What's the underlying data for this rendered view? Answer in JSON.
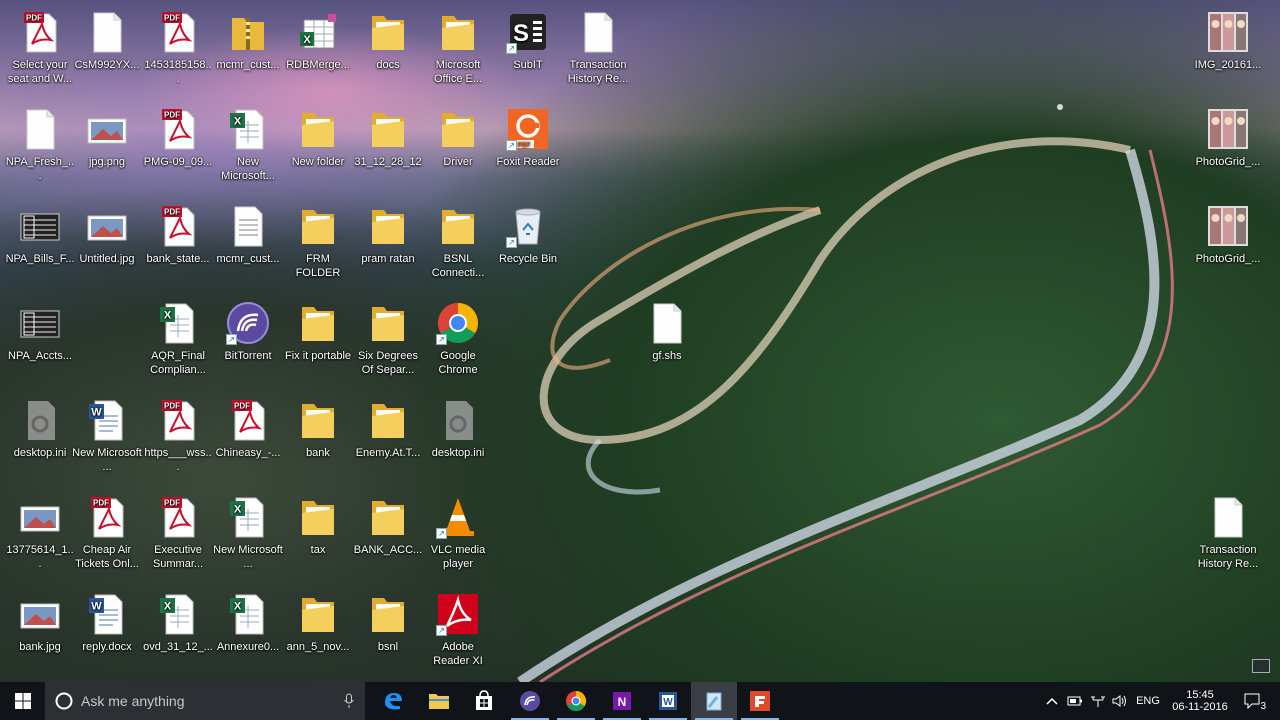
{
  "desktop": {
    "icons": [
      {
        "label": "Select your seat and W...",
        "icon": "pdf-icon"
      },
      {
        "label": "CsM992YX...",
        "icon": "blank-file-icon"
      },
      {
        "label": "1453185158...",
        "icon": "pdf-icon"
      },
      {
        "label": "mcmr_cust...",
        "icon": "zip-folder-icon"
      },
      {
        "label": "RDBMerge...",
        "icon": "excel-addin-icon"
      },
      {
        "label": "docs",
        "icon": "folder-icon"
      },
      {
        "label": "Microsoft Office E...",
        "icon": "folder-icon"
      },
      {
        "label": "SubIT",
        "icon": "subit-app-icon"
      },
      {
        "label": "Transaction History Re...",
        "icon": "blank-file-icon"
      },
      {
        "label": "NPA_Fresh_...",
        "icon": "blank-file-icon"
      },
      {
        "label": "jpg.png",
        "icon": "image-file-icon"
      },
      {
        "label": "PMG-09_09...",
        "icon": "pdf-icon"
      },
      {
        "label": "New Microsoft...",
        "icon": "excel-file-icon"
      },
      {
        "label": "New folder",
        "icon": "folder-icon"
      },
      {
        "label": "31_12_28_12",
        "icon": "folder-icon"
      },
      {
        "label": "Driver",
        "icon": "folder-icon"
      },
      {
        "label": "Foxit Reader",
        "icon": "foxit-reader-icon"
      },
      {
        "label": "NPA_Bills_F...",
        "icon": "spreadsheet-thumbnail-icon"
      },
      {
        "label": "Untitled.jpg",
        "icon": "image-file-icon"
      },
      {
        "label": "bank_state...",
        "icon": "pdf-icon"
      },
      {
        "label": "mcmr_cust...",
        "icon": "text-file-icon"
      },
      {
        "label": "FRM FOLDER",
        "icon": "folder-icon"
      },
      {
        "label": "pram ratan",
        "icon": "folder-icon"
      },
      {
        "label": "BSNL Connecti...",
        "icon": "folder-icon"
      },
      {
        "label": "Recycle Bin",
        "icon": "recycle-bin-icon"
      },
      {
        "label": "NPA_Accts...",
        "icon": "spreadsheet-thumbnail-icon"
      },
      {
        "label": "AQR_Final Complian...",
        "icon": "excel-file-icon"
      },
      {
        "label": "BitTorrent",
        "icon": "bittorrent-icon"
      },
      {
        "label": "Fix it portable",
        "icon": "folder-icon"
      },
      {
        "label": "Six Degrees Of Separ...",
        "icon": "folder-icon"
      },
      {
        "label": "Google Chrome",
        "icon": "chrome-icon"
      },
      {
        "label": "gf.shs",
        "icon": "blank-file-icon"
      },
      {
        "label": "desktop.ini",
        "icon": "settings-file-icon"
      },
      {
        "label": "New Microsoft ...",
        "icon": "word-file-icon"
      },
      {
        "label": "https___wss...",
        "icon": "pdf-icon"
      },
      {
        "label": "Chineasy_-...",
        "icon": "pdf-icon"
      },
      {
        "label": "bank",
        "icon": "folder-icon"
      },
      {
        "label": "Enemy.At.T...",
        "icon": "folder-icon"
      },
      {
        "label": "desktop.ini",
        "icon": "settings-file-icon"
      },
      {
        "label": "13775614_1...",
        "icon": "image-file-icon"
      },
      {
        "label": "Cheap Air Tickets Onl...",
        "icon": "pdf-icon"
      },
      {
        "label": "Executive Summar...",
        "icon": "pdf-icon"
      },
      {
        "label": "New Microsoft ...",
        "icon": "excel-file-icon"
      },
      {
        "label": "tax",
        "icon": "folder-icon"
      },
      {
        "label": "BANK_ACC...",
        "icon": "folder-icon"
      },
      {
        "label": "VLC media player",
        "icon": "vlc-icon"
      },
      {
        "label": "bank.jpg",
        "icon": "image-file-icon"
      },
      {
        "label": "reply.docx",
        "icon": "word-file-icon"
      },
      {
        "label": "ovd_31_12_...",
        "icon": "excel-file-icon"
      },
      {
        "label": "Annexure0...",
        "icon": "excel-file-icon"
      },
      {
        "label": "ann_5_nov...",
        "icon": "folder-icon"
      },
      {
        "label": "bsnl",
        "icon": "folder-icon"
      },
      {
        "label": "Adobe Reader XI",
        "icon": "adobe-reader-icon"
      },
      {
        "label": "IMG_20161...",
        "icon": "photo-thumbnail-icon"
      },
      {
        "label": "PhotoGrid_...",
        "icon": "photo-thumbnail-icon"
      },
      {
        "label": "PhotoGrid_...",
        "icon": "photo-thumbnail-icon"
      },
      {
        "label": "Transaction History Re...",
        "icon": "blank-file-icon"
      }
    ],
    "pdf_badge": "PDF"
  },
  "taskbar": {
    "search_placeholder": "Ask me anything",
    "apps": [
      {
        "name": "edge",
        "icon": "edge-icon"
      },
      {
        "name": "file-explorer",
        "icon": "folder-taskbar-icon"
      },
      {
        "name": "store",
        "icon": "store-icon"
      },
      {
        "name": "bittorrent",
        "icon": "bittorrent-icon"
      },
      {
        "name": "chrome",
        "icon": "chrome-icon"
      },
      {
        "name": "onenote",
        "icon": "onenote-icon"
      },
      {
        "name": "word",
        "icon": "word-icon"
      },
      {
        "name": "notepad",
        "icon": "notepad-icon"
      },
      {
        "name": "foxit",
        "icon": "foxit-icon"
      }
    ],
    "tray": {
      "language": "ENG",
      "time": "15:45",
      "date": "06-11-2016",
      "notification_count": "3"
    }
  },
  "colors": {
    "pdf_red": "#c8102e",
    "folder_yellow": "#f2c94c",
    "taskbar_bg": "#101418",
    "search_bg": "#2c2f33"
  }
}
